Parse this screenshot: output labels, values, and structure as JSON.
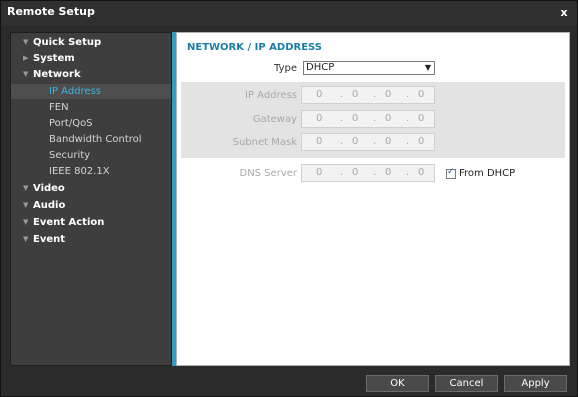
{
  "window": {
    "title": "Remote Setup",
    "close_label": "x"
  },
  "sidebar": {
    "items": [
      {
        "label": "Quick Setup",
        "level": 0,
        "arrow": "▼"
      },
      {
        "label": "System",
        "level": 0,
        "arrow": "▶"
      },
      {
        "label": "Network",
        "level": 0,
        "arrow": "▼"
      },
      {
        "label": "IP Address",
        "level": 1,
        "active": true
      },
      {
        "label": "FEN",
        "level": 1
      },
      {
        "label": "Port/QoS",
        "level": 1
      },
      {
        "label": "Bandwidth Control",
        "level": 1
      },
      {
        "label": "Security",
        "level": 1
      },
      {
        "label": "IEEE 802.1X",
        "level": 1
      },
      {
        "label": "Video",
        "level": 0,
        "arrow": "▼"
      },
      {
        "label": "Audio",
        "level": 0,
        "arrow": "▼"
      },
      {
        "label": "Event Action",
        "level": 0,
        "arrow": "▼"
      },
      {
        "label": "Event",
        "level": 0,
        "arrow": "▼"
      }
    ]
  },
  "content": {
    "section_title": "NETWORK / IP ADDRESS",
    "type_label": "Type",
    "type_value": "DHCP",
    "ip_label": "IP Address",
    "gateway_label": "Gateway",
    "subnet_label": "Subnet Mask",
    "dns_label": "DNS Server",
    "ip_value": [
      "0",
      "0",
      "0",
      "0"
    ],
    "gateway_value": [
      "0",
      "0",
      "0",
      "0"
    ],
    "subnet_value": [
      "0",
      "0",
      "0",
      "0"
    ],
    "dns_value": [
      "0",
      "0",
      "0",
      "0"
    ],
    "dot": ".",
    "from_dhcp_label": "From DHCP",
    "from_dhcp_checked": true
  },
  "footer": {
    "ok_label": "OK",
    "cancel_label": "Cancel",
    "apply_label": "Apply"
  },
  "colors": {
    "accent": "#2f9ec2",
    "section_title": "#1b7ea6",
    "active_item": "#3ab5e0"
  }
}
